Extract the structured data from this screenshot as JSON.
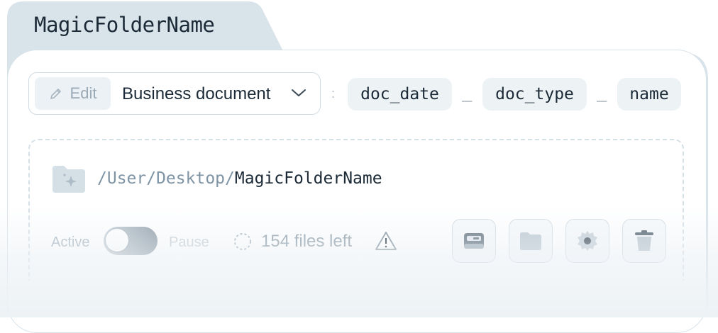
{
  "folder": {
    "title": "MagicFolderName"
  },
  "pattern": {
    "edit_label": "Edit",
    "document_type": "Business document",
    "colon": ":",
    "tokens": [
      "doc_date",
      "doc_type",
      "name"
    ],
    "separator": "_"
  },
  "location": {
    "path_prefix": "/User/Desktop/",
    "folder_name": "MagicFolderName"
  },
  "status": {
    "active_label": "Active",
    "pause_label": "Pause",
    "toggle_state": "active",
    "files_left": "154 files left"
  },
  "actions": [
    {
      "icon": "inbox-icon"
    },
    {
      "icon": "folder-icon"
    },
    {
      "icon": "gear-icon"
    },
    {
      "icon": "trash-icon"
    }
  ],
  "colors": {
    "tab_bg": "#d8e3ea",
    "chip_bg": "#edf2f5",
    "text_dark": "#1b2a36",
    "text_muted": "#7e94a5"
  }
}
